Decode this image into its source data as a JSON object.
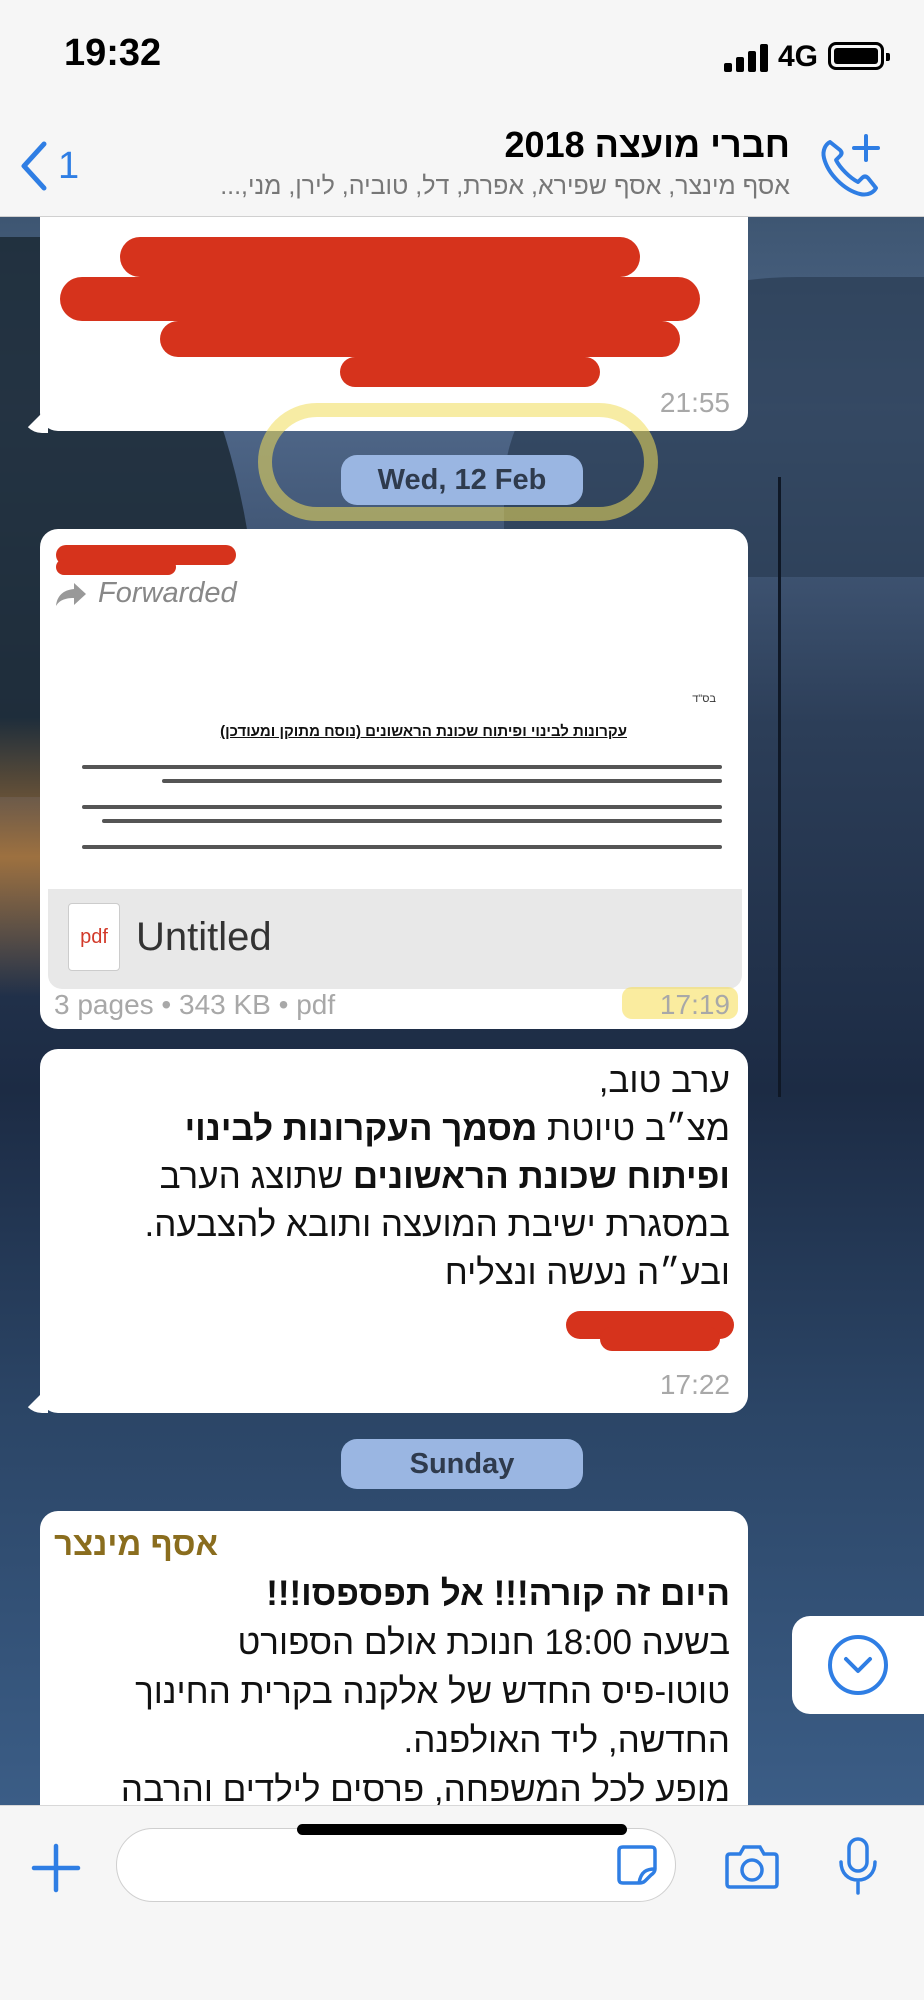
{
  "status_bar": {
    "time": "19:32",
    "network": "4G"
  },
  "header": {
    "back_count": "1",
    "title": "חברי מועצה 2018",
    "subtitle": "אסף מינצר, אסף שפירא, אפרת, דל, טוביה, לירן, מני,..."
  },
  "messages": {
    "first": {
      "time": "21:55"
    },
    "date_1": "Wed, 12 Feb",
    "doc": {
      "forwarded": "Forwarded",
      "preview_header": "בס\"ד",
      "preview_title": "עקרונות לבינוי ופיתוח שכונת הראשונים (נוסח מתוקן ומעודכן)",
      "pdf_icon": "pdf",
      "filename": "Untitled",
      "meta": "3 pages • 343 KB • pdf",
      "time": "17:19"
    },
    "text1": {
      "line1": "ערב טוב,",
      "line2_a": "מצ״ב טיוטת ",
      "line2_b": "מסמך העקרונות לבינוי",
      "line3_a": "ופיתוח שכונת הראשונים",
      "line3_b": " שתוצג הערב",
      "line4": "במסגרת ישיבת המועצה ותובא להצבעה.",
      "line5": "ובע״ה נעשה ונצליח",
      "time": "17:22"
    },
    "date_2": "Sunday",
    "text2": {
      "sender": "אסף מינצר",
      "line1": "היום זה קורה!!! אל תפספסו!!!",
      "line2": "בשעה 18:00 חנוכת אולם הספורט",
      "line3": "טוטו-פיס החדש של אלקנה בקרית החינוך",
      "line4": "החדשה, ליד האולפנה.",
      "line5": "מופע לכל המשפחה, פרסים לילדים והרבה"
    }
  },
  "colors": {
    "accent": "#2f7ee4",
    "redaction": "#d6331c",
    "sender_name": "#8a6d1e"
  }
}
